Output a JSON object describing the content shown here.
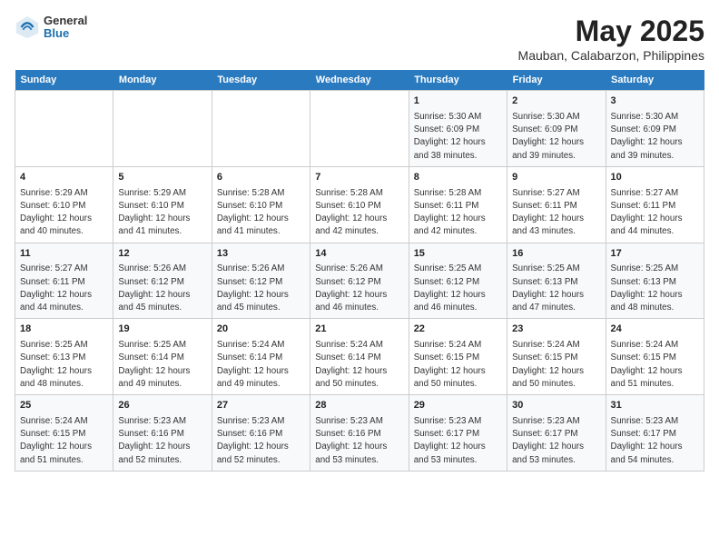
{
  "header": {
    "logo_line1": "General",
    "logo_line2": "Blue",
    "title": "May 2025",
    "subtitle": "Mauban, Calabarzon, Philippines"
  },
  "weekdays": [
    "Sunday",
    "Monday",
    "Tuesday",
    "Wednesday",
    "Thursday",
    "Friday",
    "Saturday"
  ],
  "weeks": [
    [
      {
        "day": "",
        "info": ""
      },
      {
        "day": "",
        "info": ""
      },
      {
        "day": "",
        "info": ""
      },
      {
        "day": "",
        "info": ""
      },
      {
        "day": "1",
        "info": "Sunrise: 5:30 AM\nSunset: 6:09 PM\nDaylight: 12 hours\nand 38 minutes."
      },
      {
        "day": "2",
        "info": "Sunrise: 5:30 AM\nSunset: 6:09 PM\nDaylight: 12 hours\nand 39 minutes."
      },
      {
        "day": "3",
        "info": "Sunrise: 5:30 AM\nSunset: 6:09 PM\nDaylight: 12 hours\nand 39 minutes."
      }
    ],
    [
      {
        "day": "4",
        "info": "Sunrise: 5:29 AM\nSunset: 6:10 PM\nDaylight: 12 hours\nand 40 minutes."
      },
      {
        "day": "5",
        "info": "Sunrise: 5:29 AM\nSunset: 6:10 PM\nDaylight: 12 hours\nand 41 minutes."
      },
      {
        "day": "6",
        "info": "Sunrise: 5:28 AM\nSunset: 6:10 PM\nDaylight: 12 hours\nand 41 minutes."
      },
      {
        "day": "7",
        "info": "Sunrise: 5:28 AM\nSunset: 6:10 PM\nDaylight: 12 hours\nand 42 minutes."
      },
      {
        "day": "8",
        "info": "Sunrise: 5:28 AM\nSunset: 6:11 PM\nDaylight: 12 hours\nand 42 minutes."
      },
      {
        "day": "9",
        "info": "Sunrise: 5:27 AM\nSunset: 6:11 PM\nDaylight: 12 hours\nand 43 minutes."
      },
      {
        "day": "10",
        "info": "Sunrise: 5:27 AM\nSunset: 6:11 PM\nDaylight: 12 hours\nand 44 minutes."
      }
    ],
    [
      {
        "day": "11",
        "info": "Sunrise: 5:27 AM\nSunset: 6:11 PM\nDaylight: 12 hours\nand 44 minutes."
      },
      {
        "day": "12",
        "info": "Sunrise: 5:26 AM\nSunset: 6:12 PM\nDaylight: 12 hours\nand 45 minutes."
      },
      {
        "day": "13",
        "info": "Sunrise: 5:26 AM\nSunset: 6:12 PM\nDaylight: 12 hours\nand 45 minutes."
      },
      {
        "day": "14",
        "info": "Sunrise: 5:26 AM\nSunset: 6:12 PM\nDaylight: 12 hours\nand 46 minutes."
      },
      {
        "day": "15",
        "info": "Sunrise: 5:25 AM\nSunset: 6:12 PM\nDaylight: 12 hours\nand 46 minutes."
      },
      {
        "day": "16",
        "info": "Sunrise: 5:25 AM\nSunset: 6:13 PM\nDaylight: 12 hours\nand 47 minutes."
      },
      {
        "day": "17",
        "info": "Sunrise: 5:25 AM\nSunset: 6:13 PM\nDaylight: 12 hours\nand 48 minutes."
      }
    ],
    [
      {
        "day": "18",
        "info": "Sunrise: 5:25 AM\nSunset: 6:13 PM\nDaylight: 12 hours\nand 48 minutes."
      },
      {
        "day": "19",
        "info": "Sunrise: 5:25 AM\nSunset: 6:14 PM\nDaylight: 12 hours\nand 49 minutes."
      },
      {
        "day": "20",
        "info": "Sunrise: 5:24 AM\nSunset: 6:14 PM\nDaylight: 12 hours\nand 49 minutes."
      },
      {
        "day": "21",
        "info": "Sunrise: 5:24 AM\nSunset: 6:14 PM\nDaylight: 12 hours\nand 50 minutes."
      },
      {
        "day": "22",
        "info": "Sunrise: 5:24 AM\nSunset: 6:15 PM\nDaylight: 12 hours\nand 50 minutes."
      },
      {
        "day": "23",
        "info": "Sunrise: 5:24 AM\nSunset: 6:15 PM\nDaylight: 12 hours\nand 50 minutes."
      },
      {
        "day": "24",
        "info": "Sunrise: 5:24 AM\nSunset: 6:15 PM\nDaylight: 12 hours\nand 51 minutes."
      }
    ],
    [
      {
        "day": "25",
        "info": "Sunrise: 5:24 AM\nSunset: 6:15 PM\nDaylight: 12 hours\nand 51 minutes."
      },
      {
        "day": "26",
        "info": "Sunrise: 5:23 AM\nSunset: 6:16 PM\nDaylight: 12 hours\nand 52 minutes."
      },
      {
        "day": "27",
        "info": "Sunrise: 5:23 AM\nSunset: 6:16 PM\nDaylight: 12 hours\nand 52 minutes."
      },
      {
        "day": "28",
        "info": "Sunrise: 5:23 AM\nSunset: 6:16 PM\nDaylight: 12 hours\nand 53 minutes."
      },
      {
        "day": "29",
        "info": "Sunrise: 5:23 AM\nSunset: 6:17 PM\nDaylight: 12 hours\nand 53 minutes."
      },
      {
        "day": "30",
        "info": "Sunrise: 5:23 AM\nSunset: 6:17 PM\nDaylight: 12 hours\nand 53 minutes."
      },
      {
        "day": "31",
        "info": "Sunrise: 5:23 AM\nSunset: 6:17 PM\nDaylight: 12 hours\nand 54 minutes."
      }
    ]
  ]
}
